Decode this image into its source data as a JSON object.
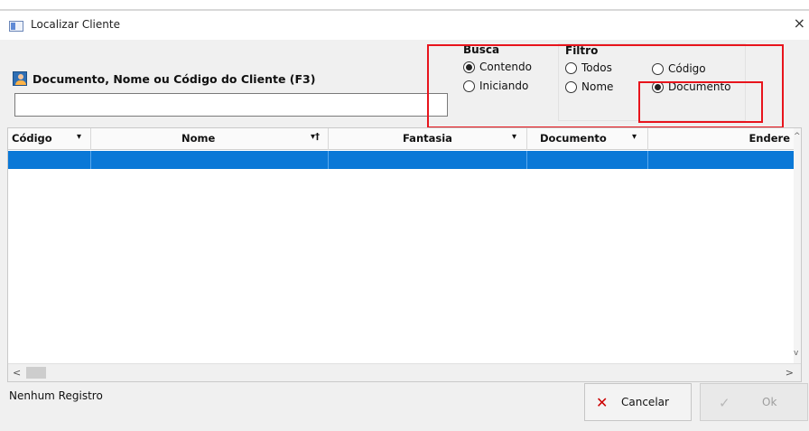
{
  "window": {
    "title": "Localizar Cliente",
    "close": "×"
  },
  "search": {
    "label": "Documento, Nome ou Código do Cliente (F3)",
    "value": "",
    "placeholder": ""
  },
  "busca": {
    "title": "Busca",
    "options": [
      {
        "label": "Contendo",
        "selected": true
      },
      {
        "label": "Iniciando",
        "selected": false
      }
    ]
  },
  "filtro": {
    "title": "Filtro",
    "options": [
      {
        "label": "Todos",
        "selected": false
      },
      {
        "label": "Código",
        "selected": false
      },
      {
        "label": "Nome",
        "selected": false
      },
      {
        "label": "Documento",
        "selected": true
      }
    ]
  },
  "grid": {
    "columns": [
      {
        "label": "Código",
        "arrow": "▾"
      },
      {
        "label": "Nome",
        "arrow": "▾†"
      },
      {
        "label": "Fantasia",
        "arrow": "▾"
      },
      {
        "label": "Documento",
        "arrow": "▾"
      },
      {
        "label": "Endere",
        "arrow": ""
      }
    ],
    "selected_row": [
      "",
      "",
      "",
      "",
      ""
    ]
  },
  "status": {
    "text": "Nenhum Registro"
  },
  "buttons": {
    "cancel": "Cancelar",
    "ok": "Ok"
  },
  "colors": {
    "highlight": "#e8141c",
    "selection": "#0a78d7",
    "cancel_icon": "#cc0000"
  }
}
